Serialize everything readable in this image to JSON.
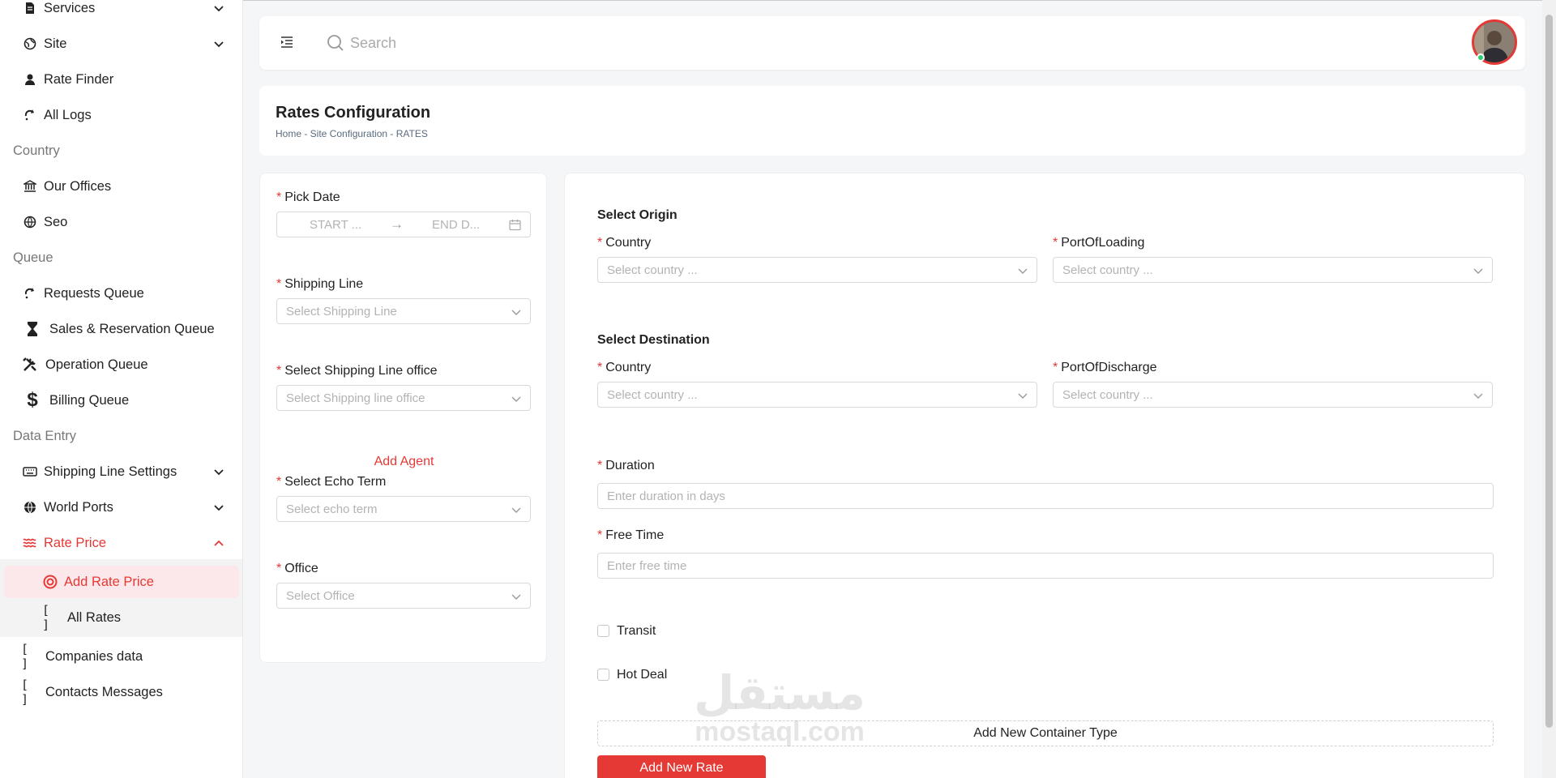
{
  "sidebar": {
    "items_top": [
      {
        "label": "Services",
        "icon": "file-icon"
      },
      {
        "label": "Site",
        "icon": "globe-icon"
      },
      {
        "label": "Rate Finder",
        "icon": "user-icon"
      },
      {
        "label": "All Logs",
        "icon": "refresh-icon"
      }
    ],
    "sections": {
      "country": "Country",
      "queue": "Queue",
      "data_entry": "Data Entry"
    },
    "country_items": [
      {
        "label": "Our Offices",
        "icon": "bank-icon"
      },
      {
        "label": "Seo",
        "icon": "globe-icon"
      }
    ],
    "queue_items": [
      {
        "label": "Requests Queue",
        "icon": "refresh-icon"
      },
      {
        "label": "Sales & Reservation Queue",
        "icon": "hourglass-icon"
      },
      {
        "label": "Operation Queue",
        "icon": "tools-icon"
      },
      {
        "label": "Billing Queue",
        "icon": "dollar-icon"
      }
    ],
    "data_entry_items": [
      {
        "label": "Shipping Line Settings",
        "icon": "keyboard-icon"
      },
      {
        "label": "World Ports",
        "icon": "globe-icon"
      },
      {
        "label": "Rate Price",
        "icon": "waves-icon"
      }
    ],
    "rate_price_sub": [
      {
        "label": "Add Rate Price",
        "icon": "target-icon"
      },
      {
        "label": "All Rates",
        "icon": "brackets-icon"
      }
    ],
    "bottom_items": [
      {
        "label": "Companies data",
        "icon": "brackets-icon"
      },
      {
        "label": "Contacts Messages",
        "icon": "brackets-icon"
      }
    ],
    "bracket_glyph": "[ ]"
  },
  "header": {
    "search_placeholder": "Search"
  },
  "page": {
    "title": "Rates Configuration",
    "breadcrumb": "Home - Site Configuration - RATES"
  },
  "left_form": {
    "pick_date": "Pick Date",
    "start_placeholder": "START ...",
    "end_placeholder": "END D...",
    "range_arrow": "→",
    "shipping_line": "Shipping Line",
    "shipping_line_placeholder": "Select Shipping Line",
    "shipping_office": "Select Shipping Line office",
    "shipping_office_placeholder": "Select Shipping line office",
    "add_agent": "Add Agent",
    "echo_term": "Select Echo Term",
    "echo_term_placeholder": "Select echo term",
    "office": "Office",
    "office_placeholder": "Select Office"
  },
  "right_form": {
    "origin_title": "Select Origin",
    "destination_title": "Select Destination",
    "country": "Country",
    "country_placeholder": "Select country ...",
    "port_loading": "PortOfLoading",
    "port_discharge": "PortOfDischarge",
    "duration": "Duration",
    "duration_placeholder": "Enter duration in days",
    "free_time": "Free Time",
    "free_time_placeholder": "Enter free time",
    "transit": "Transit",
    "hot_deal": "Hot Deal",
    "add_container": "Add New Container Type",
    "add_rate": "Add New Rate"
  },
  "required_mark": "*",
  "watermark": {
    "arabic": "مستقل",
    "latin": "mostaql.com"
  },
  "colors": {
    "accent": "#e53935",
    "selected_bg": "#fce8ea"
  }
}
